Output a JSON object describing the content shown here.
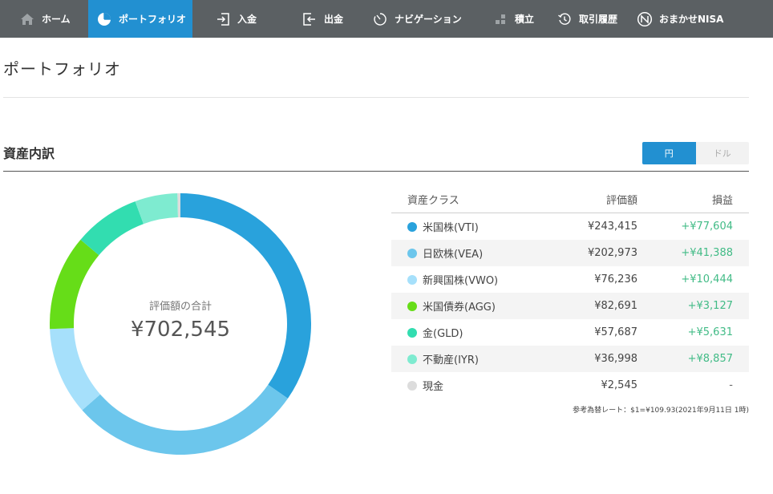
{
  "nav": {
    "items": [
      {
        "label": "ホーム",
        "icon": "home-icon",
        "active": false
      },
      {
        "label": "ポートフォリオ",
        "icon": "pie-chart-icon",
        "active": true
      },
      {
        "label": "入金",
        "icon": "deposit-icon",
        "active": false
      },
      {
        "label": "出金",
        "icon": "withdraw-icon",
        "active": false
      },
      {
        "label": "ナビゲーション",
        "icon": "timer-icon",
        "active": false
      },
      {
        "label": "積立",
        "icon": "accumulate-icon",
        "active": false
      },
      {
        "label": "取引履歴",
        "icon": "history-icon",
        "active": false
      },
      {
        "label": "おまかせNISA",
        "icon": "nisa-icon",
        "active": false
      }
    ]
  },
  "page": {
    "title": "ポートフォリオ"
  },
  "section": {
    "title": "資産内訳"
  },
  "currency": {
    "yen_label": "円",
    "dollar_label": "ドル",
    "selected": "円"
  },
  "donut": {
    "label": "評価額の合計",
    "total": "¥702,545"
  },
  "table": {
    "headers": {
      "name": "資産クラス",
      "value": "評価額",
      "gain": "損益"
    },
    "rows": [
      {
        "name": "米国株(VTI)",
        "value": "¥243,415",
        "gain": "+¥77,604",
        "color": "#29a2dc",
        "amount": 243415
      },
      {
        "name": "日欧株(VEA)",
        "value": "¥202,973",
        "gain": "+¥41,388",
        "color": "#6cc6ec",
        "amount": 202973
      },
      {
        "name": "新興国株(VWO)",
        "value": "¥76,236",
        "gain": "+¥10,444",
        "color": "#a6e0fb",
        "amount": 76236
      },
      {
        "name": "米国債券(AGG)",
        "value": "¥82,691",
        "gain": "+¥3,127",
        "color": "#66dd18",
        "amount": 82691
      },
      {
        "name": "金(GLD)",
        "value": "¥57,687",
        "gain": "+¥5,631",
        "color": "#32ddb0",
        "amount": 57687
      },
      {
        "name": "不動産(IYR)",
        "value": "¥36,998",
        "gain": "+¥8,857",
        "color": "#7eebd0",
        "amount": 36998
      },
      {
        "name": "現金",
        "value": "¥2,545",
        "gain": "-",
        "color": "#dcdcdc",
        "amount": 2545
      }
    ]
  },
  "fx_note": "参考為替レート：$1=¥109.93(2021年9月11日 1時)",
  "colors": {
    "nav_bg": "#5b6063",
    "accent": "#2290d1",
    "gain": "#41bb86"
  }
}
